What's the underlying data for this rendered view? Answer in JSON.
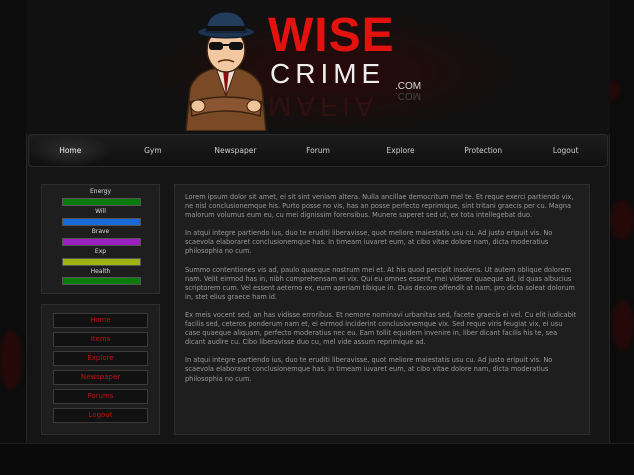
{
  "brand": {
    "word1": "WISE",
    "word2": "CRIME",
    "tld_top": ".COM",
    "tld_bottom": ".COM",
    "reflection_word": "MAFIA"
  },
  "nav": {
    "items": [
      {
        "label": "Home",
        "active": true
      },
      {
        "label": "Gym"
      },
      {
        "label": "Newspaper"
      },
      {
        "label": "Forum"
      },
      {
        "label": "Explore"
      },
      {
        "label": "Protection"
      },
      {
        "label": "Logout"
      }
    ]
  },
  "stats": [
    {
      "label": "Energy",
      "color": "#0a7a0a"
    },
    {
      "label": "Will",
      "color": "#1868d8"
    },
    {
      "label": "Brave",
      "color": "#9a20c0"
    },
    {
      "label": "Exp",
      "color": "#a0b410"
    },
    {
      "label": "Health",
      "color": "#0a7a0a"
    }
  ],
  "menu": {
    "items": [
      {
        "label": "Home"
      },
      {
        "label": "Items"
      },
      {
        "label": "Explore"
      },
      {
        "label": "Newspaper"
      },
      {
        "label": "Forums"
      },
      {
        "label": "Logout"
      }
    ]
  },
  "content": {
    "paragraphs": [
      "Lorem ipsum dolor sit amet, ei sit sint veniam altera. Nulla ancillae democritum mel te. Et reque exerci partiendo vix, ne nisl conclusionemque his. Purto posse no vis, has an posse perfecto reprimique, sint tritani graecis per cu. Magna malorum volumus eum eu, cu mei dignissim forensibus. Munere saperet sed ut, ex tota intellegebat duo.",
      "In atqui integre partiendo ius, duo te eruditi liberavisse, quot meliore maiestatis usu cu. Ad justo eripuit vis. No scaevola elaboraret conclusionemque has. In timeam iuvaret eum, at cibo vitae dolore nam, dicta moderatius philosophia no cum.",
      "Summo contentiones vis ad, paulo quaeque nostrum mei et. At his quod percipit insolens. Ut autem oblique dolorem nam. Velit eirmod has in, nibh comprehensam ei vix. Qui eu omnes essent, mei viderer quaeque ad, id quas albucius scriptorem cum. Vel essent aeterno ex, eum aperiam tibique in. Duis decore offendit at nam, pro dicta soleat dolorum in, stet elius graece ham id.",
      "Ex meis vocent sed, an has vidisse erroribus. Et nemore nominavi urbanitas sed, facete graecis ei vel. Cu elit iudicabit facilis sed, ceteros ponderum nam et, ei eirmod inciderint conclusionemque vix. Sed reque viris feugiat vix, ei usu case quaeque aliquam, perfecto moderatius nec eu. Eam tollit equidem invenire in, liber dicant facilis his te, sea dicant audire cu. Cibo liberavisse duo cu, mel vide assum reprimique ad.",
      "In atqui integre partiendo ius, duo te eruditi liberavisse, quot meliore maiestatis usu cu. Ad justo eripuit vis. No scaevola elaboraret conclusionemque has. In timeam iuvaret eum, at cibo vitae dolore nam, dicta moderatius philosophia no cum."
    ]
  }
}
